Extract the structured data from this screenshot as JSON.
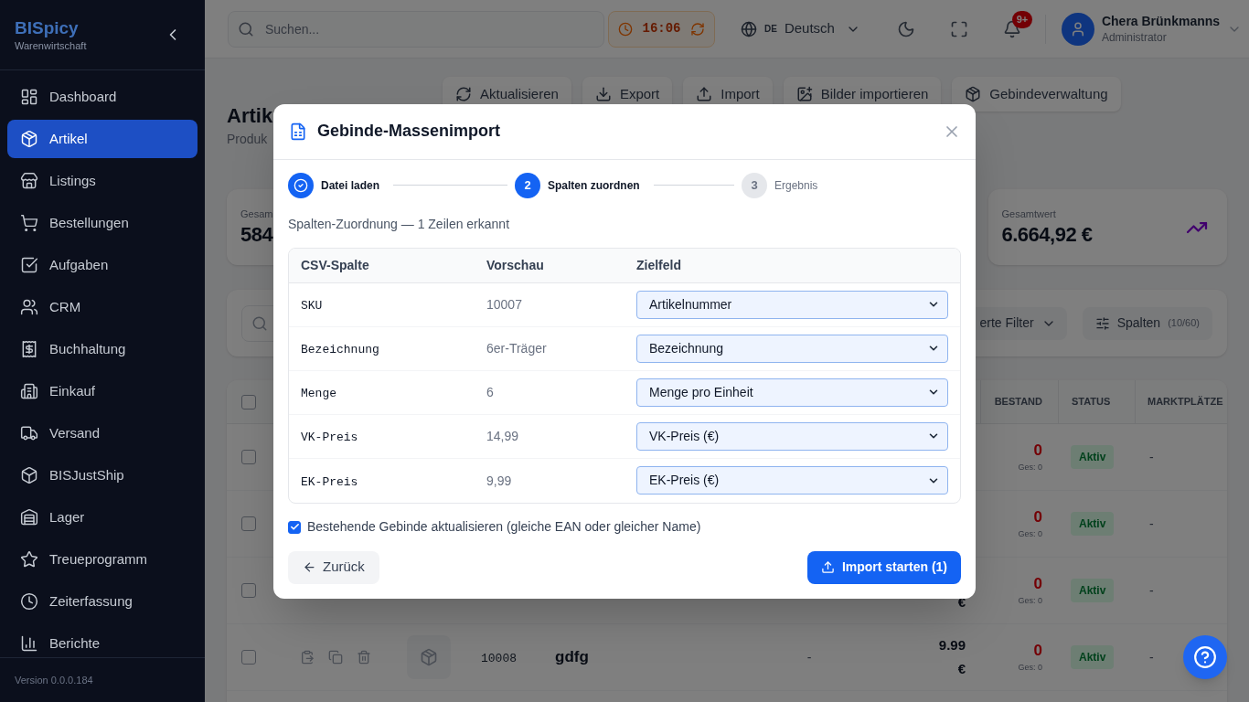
{
  "sidebar": {
    "brand": "BISpicy",
    "subtitle": "Warenwirtschaft",
    "items": [
      {
        "label": "Dashboard",
        "selected": false
      },
      {
        "label": "Artikel",
        "selected": true
      },
      {
        "label": "Listings",
        "selected": false
      },
      {
        "label": "Bestellungen",
        "selected": false
      },
      {
        "label": "Aufgaben",
        "selected": false
      },
      {
        "label": "CRM",
        "selected": false
      },
      {
        "label": "Buchhaltung",
        "selected": false
      },
      {
        "label": "Einkauf",
        "selected": false
      },
      {
        "label": "Versand",
        "selected": false
      },
      {
        "label": "BISJustShip",
        "selected": false
      },
      {
        "label": "Lager",
        "selected": false
      },
      {
        "label": "Treueprogramm",
        "selected": false
      },
      {
        "label": "Zeiterfassung",
        "selected": false
      },
      {
        "label": "Berichte",
        "selected": false
      }
    ],
    "version": "Version 0.0.0.184"
  },
  "header": {
    "search": {
      "placeholder": "Suchen..."
    },
    "timer": "16:06",
    "language": {
      "code": "DE",
      "label": "Deutsch"
    },
    "notifications_badge": "9+",
    "user": {
      "name": "Chera Brünkmanns",
      "role": "Administrator"
    }
  },
  "page": {
    "title": "Artik",
    "subtitle": "Produk",
    "actions": [
      "Aktualisieren",
      "Export",
      "Import",
      "Bilder importieren",
      "Gebindeverwaltung"
    ],
    "stats": [
      {
        "label": "Gesam",
        "value": "584"
      },
      {
        "label": "Gesamtwert",
        "value": "6.664,92 €"
      }
    ],
    "filter_bar": {
      "filter_button": "erte Filter",
      "columns_button": {
        "label": "Spalten",
        "count": "(10/60)"
      }
    },
    "table": {
      "select_all_checked": false,
      "columns": [
        "BESTAND",
        "STATUS",
        "MARKTPLÄTZE"
      ],
      "rows": [
        {
          "checked": false,
          "stock": "0",
          "stock_total": "Ges: 0",
          "status": "Aktiv",
          "marketplaces": "-"
        },
        {
          "checked": false,
          "stock": "0",
          "stock_total": "Ges: 0",
          "status": "Aktiv",
          "marketplaces": "-"
        },
        {
          "checked": false,
          "price": "€",
          "stock": "0",
          "stock_total": "Ges: 0",
          "status": "Aktiv",
          "marketplaces": "-"
        },
        {
          "checked": false,
          "actions": true,
          "thumbnail": true,
          "sku": "10008",
          "name": "gdfg",
          "column_6": "-",
          "price": "9.99 €",
          "stock": "0",
          "stock_total": "Ges: 0",
          "status": "Aktiv",
          "marketplaces": "-"
        }
      ]
    }
  },
  "dialog": {
    "title": "Gebinde-Massenimport",
    "steps": [
      {
        "kind": "done",
        "label": "Datei laden"
      },
      {
        "kind": "current",
        "number": "2",
        "label": "Spalten zuordnen"
      },
      {
        "kind": "pending",
        "number": "3",
        "label": "Ergebnis"
      }
    ],
    "summary": "Spalten-Zuordnung — 1 Zeilen erkannt",
    "mapping": {
      "columns": [
        "CSV-Spalte",
        "Vorschau",
        "Zielfeld"
      ],
      "rows": [
        {
          "csv_column": "SKU",
          "preview": "10007",
          "target_field": "Artikelnummer"
        },
        {
          "csv_column": "Bezeichnung",
          "preview": "6er-Träger",
          "target_field": "Bezeichnung"
        },
        {
          "csv_column": "Menge",
          "preview": "6",
          "target_field": "Menge pro Einheit"
        },
        {
          "csv_column": "VK-Preis",
          "preview": "14,99",
          "target_field": "VK-Preis (€)"
        },
        {
          "csv_column": "EK-Preis",
          "preview": "9,99",
          "target_field": "EK-Preis (€)"
        }
      ]
    },
    "update_existing": {
      "label": "Bestehende Gebinde aktualisieren (gleiche EAN oder gleicher Name)",
      "checked": true
    },
    "back_button": "Zurück",
    "import_button": "Import starten (1)"
  }
}
